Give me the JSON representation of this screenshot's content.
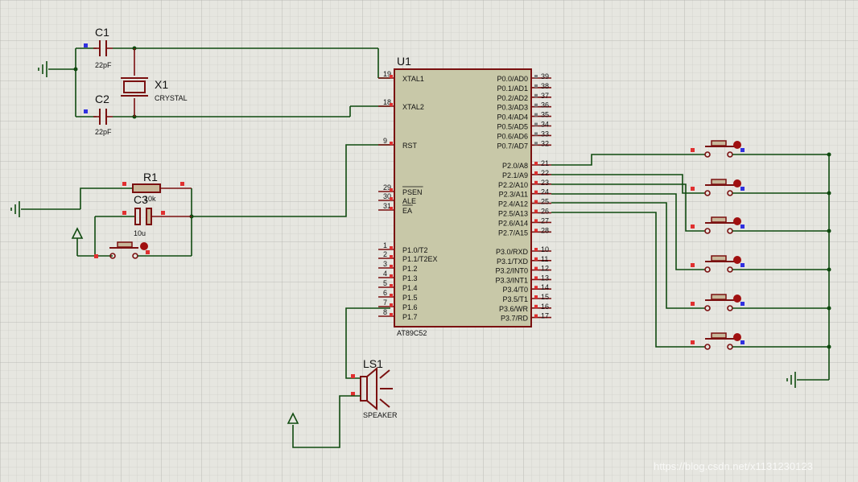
{
  "colors": {
    "background": "#e6e6e0",
    "grid": "#c8c8c2",
    "wire": "#0f4a0f",
    "component": "#7a1010",
    "chip_fill": "#c8c8a8",
    "pin_red": "#e03030",
    "pin_blue": "#3030e0",
    "pin_gray": "#808080"
  },
  "chip": {
    "ref": "U1",
    "part": "AT89C52",
    "left_pins": [
      {
        "num": "19",
        "name": "XTAL1"
      },
      {
        "num": "18",
        "name": "XTAL2"
      },
      {
        "num": "9",
        "name": "RST"
      },
      {
        "num": "29",
        "name": "PSEN"
      },
      {
        "num": "30",
        "name": "ALE"
      },
      {
        "num": "31",
        "name": "EA"
      },
      {
        "num": "1",
        "name": "P1.0/T2"
      },
      {
        "num": "2",
        "name": "P1.1/T2EX"
      },
      {
        "num": "3",
        "name": "P1.2"
      },
      {
        "num": "4",
        "name": "P1.3"
      },
      {
        "num": "5",
        "name": "P1.4"
      },
      {
        "num": "6",
        "name": "P1.5"
      },
      {
        "num": "7",
        "name": "P1.6"
      },
      {
        "num": "8",
        "name": "P1.7"
      }
    ],
    "right_pins": [
      {
        "num": "39",
        "name": "P0.0/AD0"
      },
      {
        "num": "38",
        "name": "P0.1/AD1"
      },
      {
        "num": "37",
        "name": "P0.2/AD2"
      },
      {
        "num": "36",
        "name": "P0.3/AD3"
      },
      {
        "num": "35",
        "name": "P0.4/AD4"
      },
      {
        "num": "34",
        "name": "P0.5/AD5"
      },
      {
        "num": "33",
        "name": "P0.6/AD6"
      },
      {
        "num": "32",
        "name": "P0.7/AD7"
      },
      {
        "num": "21",
        "name": "P2.0/A8"
      },
      {
        "num": "22",
        "name": "P2.1/A9"
      },
      {
        "num": "23",
        "name": "P2.2/A10"
      },
      {
        "num": "24",
        "name": "P2.3/A11"
      },
      {
        "num": "25",
        "name": "P2.4/A12"
      },
      {
        "num": "26",
        "name": "P2.5/A13"
      },
      {
        "num": "27",
        "name": "P2.6/A14"
      },
      {
        "num": "28",
        "name": "P2.7/A15"
      },
      {
        "num": "10",
        "name": "P3.0/RXD"
      },
      {
        "num": "11",
        "name": "P3.1/TXD"
      },
      {
        "num": "12",
        "name": "P3.2/INT0"
      },
      {
        "num": "13",
        "name": "P3.3/INT1"
      },
      {
        "num": "14",
        "name": "P3.4/T0"
      },
      {
        "num": "15",
        "name": "P3.5/T1"
      },
      {
        "num": "16",
        "name": "P3.6/WR"
      },
      {
        "num": "17",
        "name": "P3.7/RD"
      }
    ]
  },
  "components": {
    "c1": {
      "ref": "C1",
      "value": "22pF"
    },
    "c2": {
      "ref": "C2",
      "value": "22pF"
    },
    "x1": {
      "ref": "X1",
      "value": "CRYSTAL"
    },
    "r1": {
      "ref": "R1",
      "value": "10k"
    },
    "c3": {
      "ref": "C3",
      "value": "10u"
    },
    "ls1": {
      "ref": "LS1",
      "value": "SPEAKER"
    }
  },
  "watermark": "https://blog.csdn.net/x1131230123"
}
